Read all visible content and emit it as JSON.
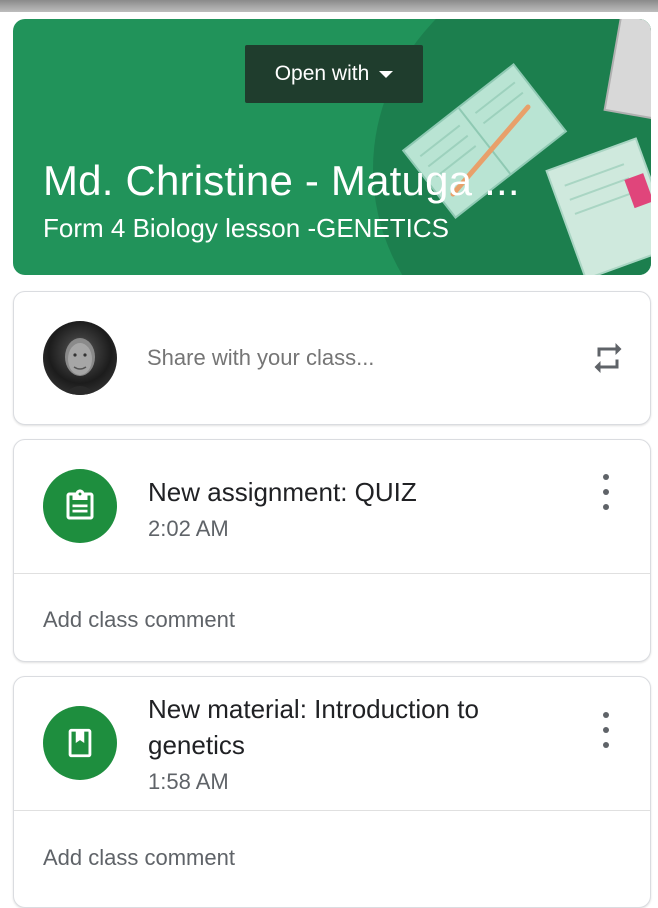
{
  "banner": {
    "open_with_label": "Open with",
    "class_title": "Md. Christine - Matuga ...",
    "class_subtitle": "Form 4 Biology lesson -GENETICS",
    "background_color": "#21935a"
  },
  "share": {
    "placeholder": "Share with your class...",
    "avatar_icon": "user-avatar",
    "action_icon": "repost-icon"
  },
  "posts": [
    {
      "icon": "assignment-icon",
      "title": "New assignment: QUIZ",
      "time": "2:02 AM",
      "comment_label": "Add class comment"
    },
    {
      "icon": "material-icon",
      "title": "New material: Introduction to genetics",
      "time": "1:58 AM",
      "comment_label": "Add class comment"
    }
  ],
  "colors": {
    "accent": "#1e8e3e",
    "text_primary": "#202124",
    "text_secondary": "#5f6368"
  }
}
